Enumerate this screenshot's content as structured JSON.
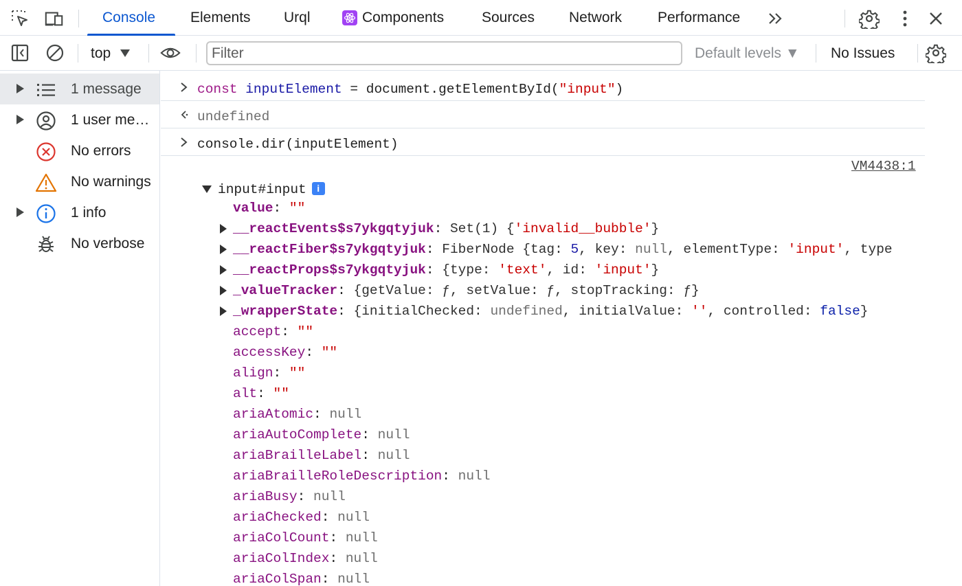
{
  "tabs": {
    "items": [
      {
        "label": "Console",
        "active": true
      },
      {
        "label": "Elements"
      },
      {
        "label": "Urql"
      },
      {
        "label": "Components",
        "icon": "react-icon"
      },
      {
        "label": "Sources"
      },
      {
        "label": "Network"
      },
      {
        "label": "Performance"
      }
    ],
    "more_label": "»"
  },
  "toolbar": {
    "context": "top",
    "filter_placeholder": "Filter",
    "levels": "Default levels ▼",
    "issues": "No Issues"
  },
  "sidebar": {
    "items": [
      {
        "label": "1 message",
        "icon": "list-icon"
      },
      {
        "label": "1 user me…",
        "icon": "user-icon"
      },
      {
        "label": "No errors",
        "icon": "error-icon"
      },
      {
        "label": "No warnings",
        "icon": "warning-icon"
      },
      {
        "label": "1 info",
        "icon": "info-icon"
      },
      {
        "label": "No verbose",
        "icon": "bug-icon"
      }
    ]
  },
  "console": {
    "line1": {
      "kw": "const",
      "var": "inputElement",
      "mid": " = document.getElementById(",
      "str": "\"input\"",
      "end": ")"
    },
    "line2": "undefined",
    "line3": "console.dir(inputElement)",
    "source": "VM4438:1",
    "node": "input#input",
    "props": [
      {
        "key": "value",
        "parts": [
          {
            "t": "\"\"",
            "c": "val-str"
          }
        ],
        "own": true
      },
      {
        "key": "__reactEvents$s7ykgqtyjuk",
        "own": true,
        "expand": true,
        "parts": [
          {
            "t": "Set(1) {",
            "c": "val-obj"
          },
          {
            "t": "'invalid__bubble'",
            "c": "val-str"
          },
          {
            "t": "}",
            "c": "val-obj"
          }
        ]
      },
      {
        "key": "__reactFiber$s7ykgqtyjuk",
        "own": true,
        "expand": true,
        "parts": [
          {
            "t": "FiberNode {tag: ",
            "c": "val-obj"
          },
          {
            "t": "5",
            "c": "val-num"
          },
          {
            "t": ", key: ",
            "c": "val-obj"
          },
          {
            "t": "null",
            "c": "val-null"
          },
          {
            "t": ", elementType: ",
            "c": "val-obj"
          },
          {
            "t": "'input'",
            "c": "val-str"
          },
          {
            "t": ", type",
            "c": "val-obj"
          }
        ]
      },
      {
        "key": "__reactProps$s7ykgqtyjuk",
        "own": true,
        "expand": true,
        "parts": [
          {
            "t": "{type: ",
            "c": "val-obj"
          },
          {
            "t": "'text'",
            "c": "val-str"
          },
          {
            "t": ", id: ",
            "c": "val-obj"
          },
          {
            "t": "'input'",
            "c": "val-str"
          },
          {
            "t": "}",
            "c": "val-obj"
          }
        ]
      },
      {
        "key": "_valueTracker",
        "own": true,
        "expand": true,
        "parts": [
          {
            "t": "{getValue: ",
            "c": "val-obj"
          },
          {
            "t": "ƒ",
            "c": "val-obj"
          },
          {
            "t": ", setValue: ",
            "c": "val-obj"
          },
          {
            "t": "ƒ",
            "c": "val-obj"
          },
          {
            "t": ", stopTracking: ",
            "c": "val-obj"
          },
          {
            "t": "ƒ",
            "c": "val-obj"
          },
          {
            "t": "}",
            "c": "val-obj"
          }
        ]
      },
      {
        "key": "_wrapperState",
        "own": true,
        "expand": true,
        "parts": [
          {
            "t": "{initialChecked: ",
            "c": "val-obj"
          },
          {
            "t": "undefined",
            "c": "val-null"
          },
          {
            "t": ", initialValue: ",
            "c": "val-obj"
          },
          {
            "t": "''",
            "c": "val-str"
          },
          {
            "t": ", controlled: ",
            "c": "val-obj"
          },
          {
            "t": "false",
            "c": "val-bool"
          },
          {
            "t": "}",
            "c": "val-obj"
          }
        ]
      },
      {
        "key": "accept",
        "parts": [
          {
            "t": "\"\"",
            "c": "val-str"
          }
        ]
      },
      {
        "key": "accessKey",
        "parts": [
          {
            "t": "\"\"",
            "c": "val-str"
          }
        ]
      },
      {
        "key": "align",
        "parts": [
          {
            "t": "\"\"",
            "c": "val-str"
          }
        ]
      },
      {
        "key": "alt",
        "parts": [
          {
            "t": "\"\"",
            "c": "val-str"
          }
        ]
      },
      {
        "key": "ariaAtomic",
        "parts": [
          {
            "t": "null",
            "c": "val-null"
          }
        ]
      },
      {
        "key": "ariaAutoComplete",
        "parts": [
          {
            "t": "null",
            "c": "val-null"
          }
        ]
      },
      {
        "key": "ariaBrailleLabel",
        "parts": [
          {
            "t": "null",
            "c": "val-null"
          }
        ]
      },
      {
        "key": "ariaBrailleRoleDescription",
        "parts": [
          {
            "t": "null",
            "c": "val-null"
          }
        ]
      },
      {
        "key": "ariaBusy",
        "parts": [
          {
            "t": "null",
            "c": "val-null"
          }
        ]
      },
      {
        "key": "ariaChecked",
        "parts": [
          {
            "t": "null",
            "c": "val-null"
          }
        ]
      },
      {
        "key": "ariaColCount",
        "parts": [
          {
            "t": "null",
            "c": "val-null"
          }
        ]
      },
      {
        "key": "ariaColIndex",
        "parts": [
          {
            "t": "null",
            "c": "val-null"
          }
        ]
      },
      {
        "key": "ariaColSpan",
        "parts": [
          {
            "t": "null",
            "c": "val-null"
          }
        ]
      }
    ]
  }
}
